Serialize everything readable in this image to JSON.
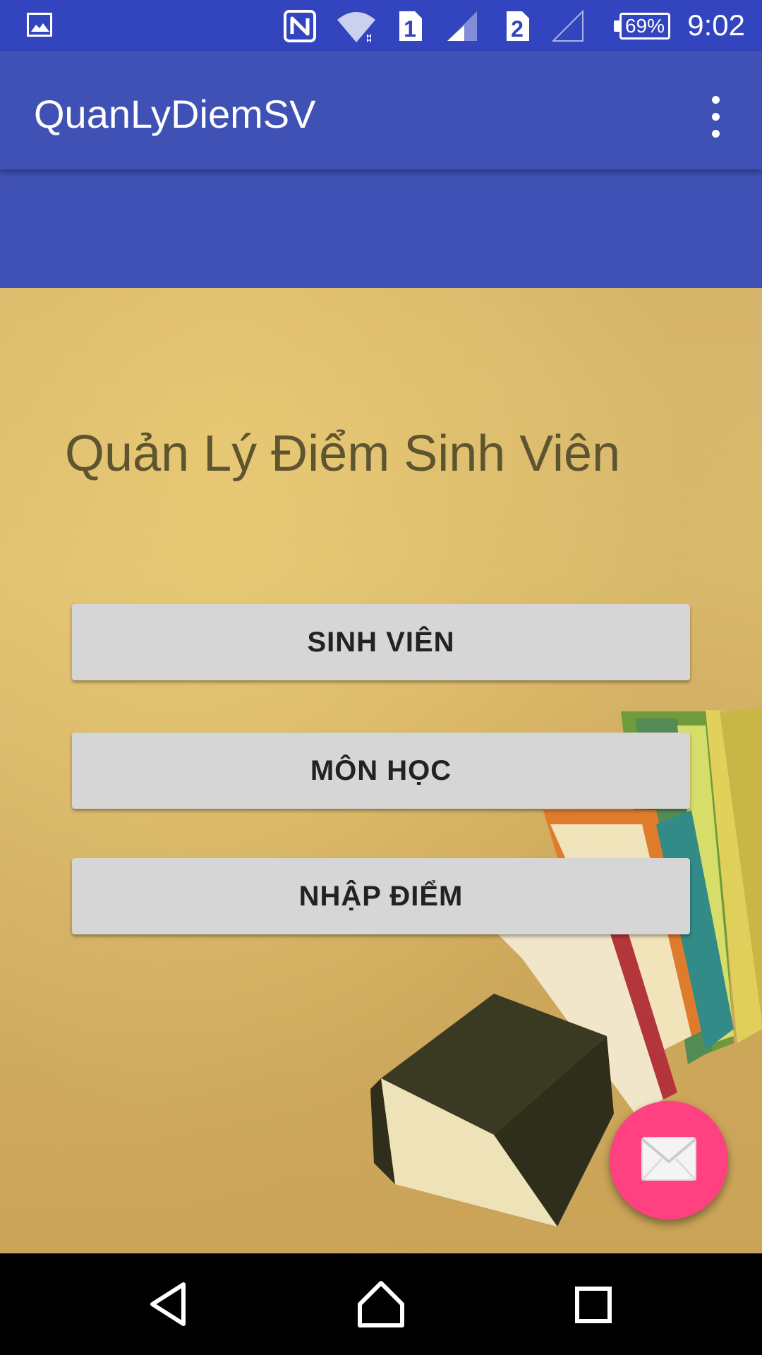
{
  "status_bar": {
    "battery_percent": "69%",
    "time": "9:02",
    "sim1_label": "1",
    "sim2_label": "2",
    "icons": [
      "gallery-icon",
      "nfc-icon",
      "wifi-icon",
      "sim1-icon",
      "signal-icon",
      "sim2-icon",
      "no-signal-icon",
      "battery-icon"
    ]
  },
  "app_bar": {
    "title": "QuanLyDiemSV",
    "menu_icon": "overflow-menu-icon"
  },
  "main": {
    "heading": "Quản Lý Điểm Sinh Viên",
    "buttons": [
      {
        "label": "SINH VIÊN"
      },
      {
        "label": "MÔN HỌC"
      },
      {
        "label": "NHẬP ĐIỂM"
      }
    ]
  },
  "fab": {
    "icon": "mail-icon"
  },
  "nav_bar": {
    "icons": [
      "back-icon",
      "home-icon",
      "recents-icon"
    ]
  },
  "colors": {
    "status_bar": "#3344bf",
    "app_bar": "#3f51b5",
    "fab": "#ff4081",
    "button": "#d6d6d6",
    "heading_text": "#5e5430"
  }
}
